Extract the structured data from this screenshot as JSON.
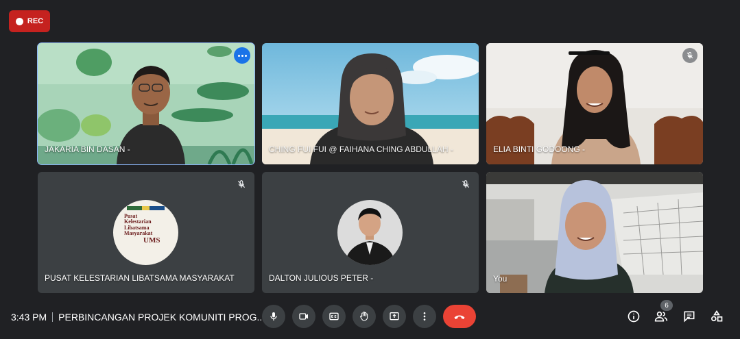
{
  "recording": {
    "label": "REC"
  },
  "participants": [
    {
      "name": "JAKARIA BIN DASAN -"
    },
    {
      "name": "CHING FUI FUI @ FAIHANA CHING ABDULLAH -"
    },
    {
      "name": "ELIA BINTI GODOONG -"
    },
    {
      "name": "PUSAT KELESTARIAN LIBATSAMA MASYARAKAT"
    },
    {
      "name": "DALTON JULIOUS PETER -"
    },
    {
      "name": "You"
    }
  ],
  "logo": {
    "line1": "Pusat",
    "line2": "Kelestarian",
    "line3": "Libatsama",
    "line4": "Masyarakat",
    "line5": "UMS"
  },
  "meeting": {
    "time": "3:43 PM",
    "title": "PERBINCANGAN PROJEK KOMUNITI PROG..."
  },
  "people_count": "6",
  "colors": {
    "end_call": "#ea4335",
    "rec": "#c5221f",
    "active_border": "#8ab4f8",
    "more_button": "#1a73e8"
  },
  "icons": [
    "mic-icon",
    "camera-icon",
    "captions-icon",
    "raise-hand-icon",
    "present-icon",
    "more-vert-icon",
    "end-call-icon",
    "info-icon",
    "people-icon",
    "chat-icon",
    "activities-icon",
    "mic-off-icon"
  ]
}
